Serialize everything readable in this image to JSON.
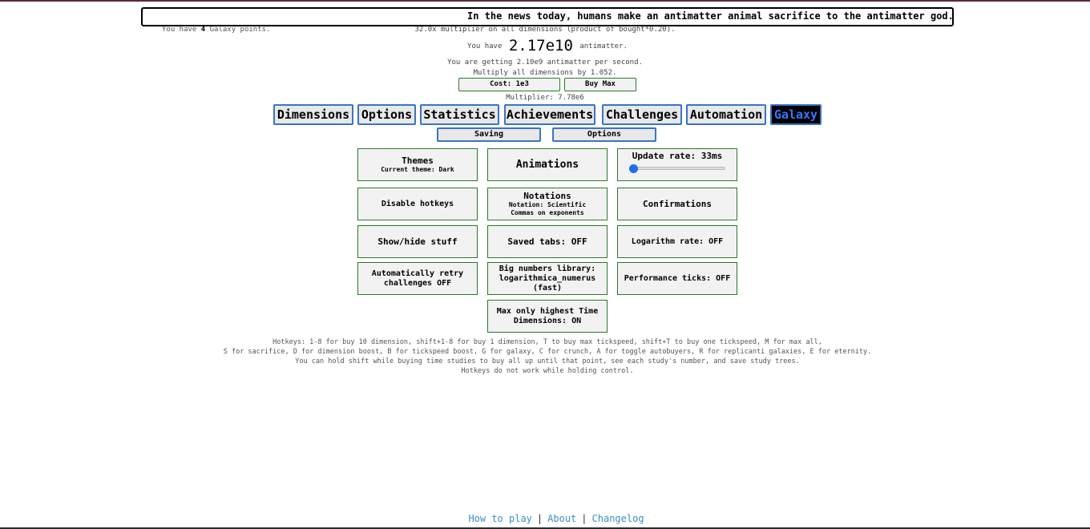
{
  "news": "In the news today, humans make an antimatter animal sacrifice to the antimatter god.",
  "galaxy_points": {
    "prefix": "You have",
    "value": "4",
    "suffix": "Galaxy points."
  },
  "multiplier_line": "32.0x multiplier on all dimensions (product of bought*0.20).",
  "antimatter": {
    "prefix": "You have",
    "value": "2.17e10",
    "suffix": "antimatter."
  },
  "rate_line": "You are getting 2.10e9 antimatter per second.",
  "multiply_line": "Multiply all dimensions by 1.052.",
  "tickspeed": {
    "cost_label": "Cost: 1e3",
    "buymax_label": "Buy Max",
    "multiplier": "Multiplier: 7.78e6"
  },
  "tabs": [
    {
      "label": "Dimensions"
    },
    {
      "label": "Options"
    },
    {
      "label": "Statistics"
    },
    {
      "label": "Achievements"
    },
    {
      "label": "Challenges"
    },
    {
      "label": "Automation"
    },
    {
      "label": "Galaxy",
      "active": true
    }
  ],
  "subtabs": [
    {
      "label": "Saving"
    },
    {
      "label": "Options"
    }
  ],
  "options": {
    "themes": {
      "title": "Themes",
      "sub": "Current theme: Dark"
    },
    "animations": "Animations",
    "update_rate": "Update rate: 33ms",
    "update_rate_level": 0,
    "disable_hotkeys": "Disable hotkeys",
    "notations": {
      "title": "Notations",
      "sub1": "Notation: Scientific",
      "sub2": "Commas on exponents"
    },
    "confirmations": "Confirmations",
    "show_hide": "Show/hide stuff",
    "saved_tabs": "Saved tabs: OFF",
    "log_rate": "Logarithm rate: OFF",
    "auto_retry": {
      "line1": "Automatically retry",
      "line2": "challenges OFF"
    },
    "big_numbers": {
      "line1": "Big numbers library:",
      "line2": "logarithmica_numerus",
      "line3": "(fast)"
    },
    "perf_ticks": "Performance ticks: OFF",
    "max_time": {
      "line1": "Max only highest Time",
      "line2": "Dimensions: ON"
    }
  },
  "hotkeys": [
    "Hotkeys: 1-8 for buy 10 dimension, shift+1-8 for buy 1 dimension, T to buy max tickspeed, shift+T to buy one tickspeed, M for max all,",
    "S for sacrifice, D for dimension boost, B for tickspeed boost, G for galaxy, C for crunch, A for toggle autobuyers, R for replicanti galaxies, E for eternity.",
    "You can hold shift while buying time studies to buy all up until that point, see each study's number, and save study trees.",
    "Hotkeys do not work while holding control."
  ],
  "footer": {
    "how_to_play": "How to play",
    "about": "About",
    "changelog": "Changelog",
    "sep": "|"
  },
  "colors": {
    "tab_border": "#3b74c4",
    "button_border": "#2a7a2a",
    "link": "#3a8fc4",
    "active_tab_text": "#3b74ff"
  }
}
